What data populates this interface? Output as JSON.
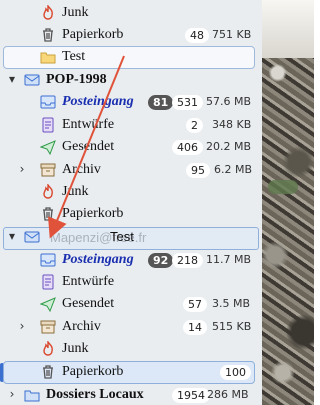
{
  "colors": {
    "pane_bg": "#e9edf0",
    "selection_border": "#9fb9dc",
    "drag_arrow": "#e0533a",
    "inbox_label": "#1a2fb0"
  },
  "rows": [
    {
      "label": "Junk",
      "icon": "junk-icon"
    },
    {
      "label": "Papierkorb",
      "icon": "trash-icon",
      "count": "48",
      "size": "751 KB"
    },
    {
      "label": "Test",
      "icon": "folder-icon"
    },
    {
      "label": "POP-1998",
      "icon": "account-icon",
      "twisty": "▾"
    },
    {
      "label": "Posteingang",
      "icon": "inbox-icon",
      "unread": "81",
      "count": "531",
      "size": "57.6 MB"
    },
    {
      "label": "Entwürfe",
      "icon": "drafts-icon",
      "count": "2",
      "size": "348 KB"
    },
    {
      "label": "Gesendet",
      "icon": "sent-icon",
      "count": "406",
      "size": "20.2 MB"
    },
    {
      "label": "Archiv",
      "icon": "archive-icon",
      "count": "95",
      "size": "6.2 MB",
      "twisty": "›"
    },
    {
      "label": "Junk",
      "icon": "junk-icon"
    },
    {
      "label": "Papierkorb",
      "icon": "trash-icon"
    },
    {
      "label": "Mapenzi@free.fr",
      "icon": "account-icon",
      "twisty": "▾"
    },
    {
      "label": "Posteingang",
      "icon": "inbox-icon",
      "unread": "92",
      "count": "218",
      "size": "11.7 MB"
    },
    {
      "label": "Entwürfe",
      "icon": "drafts-icon"
    },
    {
      "label": "Gesendet",
      "icon": "sent-icon",
      "count": "57",
      "size": "3.5 MB"
    },
    {
      "label": "Archiv",
      "icon": "archive-icon",
      "count": "14",
      "size": "515 KB",
      "twisty": "›"
    },
    {
      "label": "Junk",
      "icon": "junk-icon"
    },
    {
      "label": "Papierkorb",
      "icon": "trash-icon",
      "count": "100"
    },
    {
      "label": "Dossiers Locaux",
      "icon": "local-folders-icon",
      "count": "1954",
      "size": "286 MB",
      "twisty": "›"
    }
  ],
  "drag": {
    "ghost_label": "Test"
  }
}
